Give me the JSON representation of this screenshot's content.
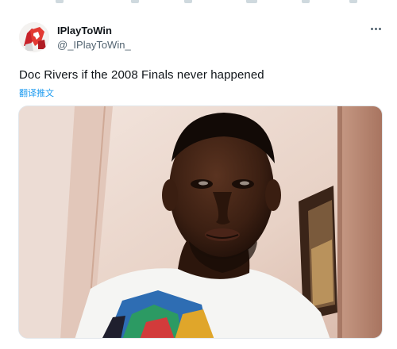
{
  "tweet": {
    "display_name": "IPlayToWin",
    "handle": "@_IPlayToWin_",
    "text": "Doc Rivers if the 2008 Finals never happened",
    "translate_label": "翻译推文"
  },
  "icons": {
    "more": "more-horizontal-icon",
    "avatar": "avatar-image"
  },
  "colors": {
    "link": "#1d9bf0",
    "text": "#0f1419",
    "muted": "#536471"
  }
}
